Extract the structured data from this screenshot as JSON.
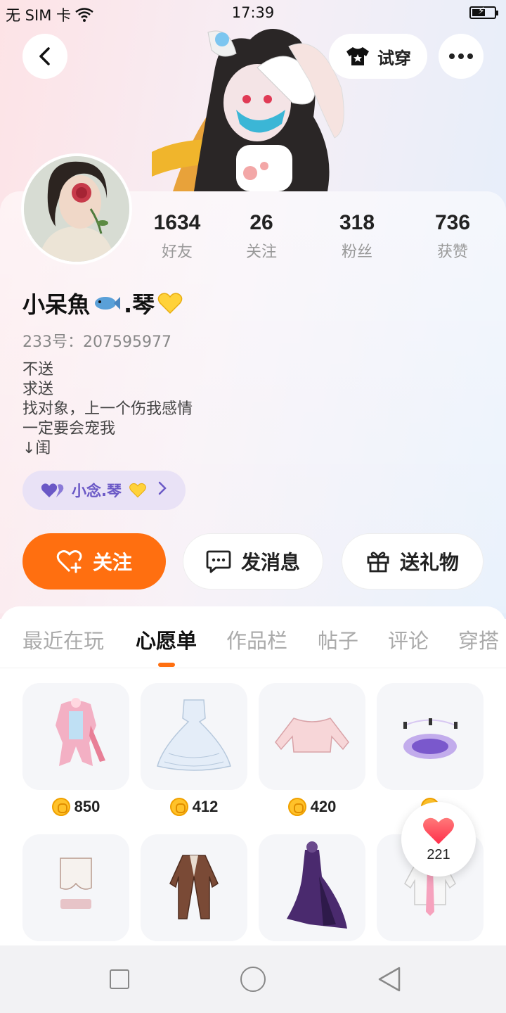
{
  "status_bar": {
    "carrier": "无 SIM 卡",
    "time": "17:39",
    "battery_level": 0.6
  },
  "header": {
    "back_icon": "chevron-left-icon",
    "tryon_label": "试穿",
    "tryon_icon": "tshirt-star-icon",
    "more_icon": "more-dots-icon"
  },
  "profile": {
    "stats": [
      {
        "value": "1634",
        "label": "好友"
      },
      {
        "value": "26",
        "label": "关注"
      },
      {
        "value": "318",
        "label": "粉丝"
      },
      {
        "value": "736",
        "label": "获赞"
      }
    ],
    "nickname_part1": "小呆魚",
    "nickname_part2": ".琴",
    "uid": "233号：207595977",
    "bio_lines": [
      "不送",
      "求送",
      "找对象，上一个伤我感情",
      "一定要会宠我",
      "↓闺"
    ],
    "pair_chip": {
      "label": "小念.琴",
      "icon": "double-heart-icon"
    }
  },
  "actions": {
    "follow": "关注",
    "message": "发消息",
    "gift": "送礼物"
  },
  "tabs": [
    {
      "label": "最近在玩",
      "active": false
    },
    {
      "label": "心愿单",
      "active": true
    },
    {
      "label": "作品栏",
      "active": false
    },
    {
      "label": "帖子",
      "active": false
    },
    {
      "label": "评论",
      "active": false
    },
    {
      "label": "穿搭",
      "active": false
    }
  ],
  "wishlist": {
    "row1": [
      {
        "name": "pink-outfit",
        "price": "850"
      },
      {
        "name": "white-gown",
        "price": "412"
      },
      {
        "name": "pink-sweater",
        "price": "420"
      },
      {
        "name": "purple-magic-circle",
        "price": ""
      }
    ],
    "row2": [
      {
        "name": "white-shorts"
      },
      {
        "name": "brown-coat"
      },
      {
        "name": "dark-dress"
      },
      {
        "name": "white-shirt"
      }
    ]
  },
  "like_float": {
    "count": "221",
    "icon": "heart-icon"
  },
  "colors": {
    "accent": "#ff6f10",
    "pair_chip_bg": "#e9e2f6",
    "pair_chip_text": "#6a58c6"
  }
}
